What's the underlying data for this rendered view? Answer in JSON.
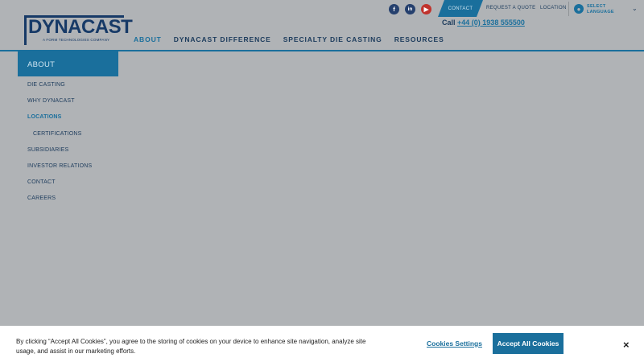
{
  "logo": {
    "word": "DYNACAST",
    "tagline": "A FORM TECHNOLOGIES COMPANY"
  },
  "nav": [
    {
      "label": "ABOUT",
      "active": true
    },
    {
      "label": "DYNACAST DIFFERENCE"
    },
    {
      "label": "SPECIALTY DIE CASTING"
    },
    {
      "label": "RESOURCES"
    }
  ],
  "social": {
    "facebook": "f",
    "linkedin": "in",
    "youtube": "▶"
  },
  "utility": {
    "contact": "CONTACT",
    "quote": "REQUEST A QUOTE",
    "location": "LOCATION"
  },
  "language": {
    "label": "SELECT LANGUAGE",
    "icon": "globe-icon"
  },
  "call": {
    "prefix": "Call",
    "number": "+44 (0) 1938 555500"
  },
  "sidebar": {
    "heading": "ABOUT",
    "items": [
      {
        "label": "DIE CASTING"
      },
      {
        "label": "WHY DYNACAST"
      },
      {
        "label": "LOCATIONS",
        "active": true
      },
      {
        "label": "CERTIFICATIONS",
        "sub": true
      },
      {
        "label": "SUBSIDIARIES"
      },
      {
        "label": "INVESTOR RELATIONS"
      },
      {
        "label": "CONTACT"
      },
      {
        "label": "CAREERS"
      }
    ]
  },
  "cookie": {
    "text": "By clicking “Accept All Cookies”, you agree to the storing of cookies on your device to enhance site navigation, analyze site usage, and assist in our marketing efforts.",
    "settings": "Cookies Settings",
    "accept": "Accept All Cookies",
    "close": "×"
  },
  "colors": {
    "accent": "#1a6f9c",
    "navy": "#173a67",
    "overlay": "#b0b3b6"
  }
}
